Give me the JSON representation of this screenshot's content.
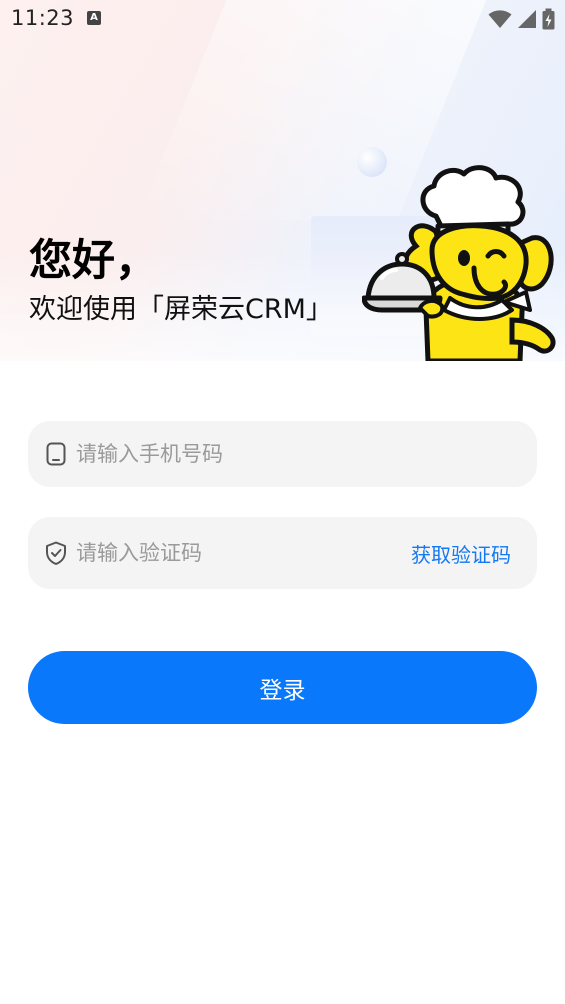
{
  "status_bar": {
    "time": "11:23",
    "indicator": "A"
  },
  "hero": {
    "greeting": "您好，",
    "welcome": "欢迎使用「屏荣云CRM」"
  },
  "form": {
    "phone_placeholder": "请输入手机号码",
    "phone_value": "",
    "code_placeholder": "请输入验证码",
    "code_value": "",
    "get_code_label": "获取验证码",
    "login_label": "登录"
  },
  "icons": {
    "phone": "phone-outline-icon",
    "code": "shield-check-icon",
    "wifi": "wifi-icon",
    "signal": "signal-icon",
    "battery": "battery-charging-icon",
    "mascot": "chef-elephant-mascot"
  },
  "colors": {
    "accent": "#0a78fb",
    "link": "#1479f2",
    "field_bg": "#f4f4f5",
    "mascot_yellow": "#fde515"
  }
}
